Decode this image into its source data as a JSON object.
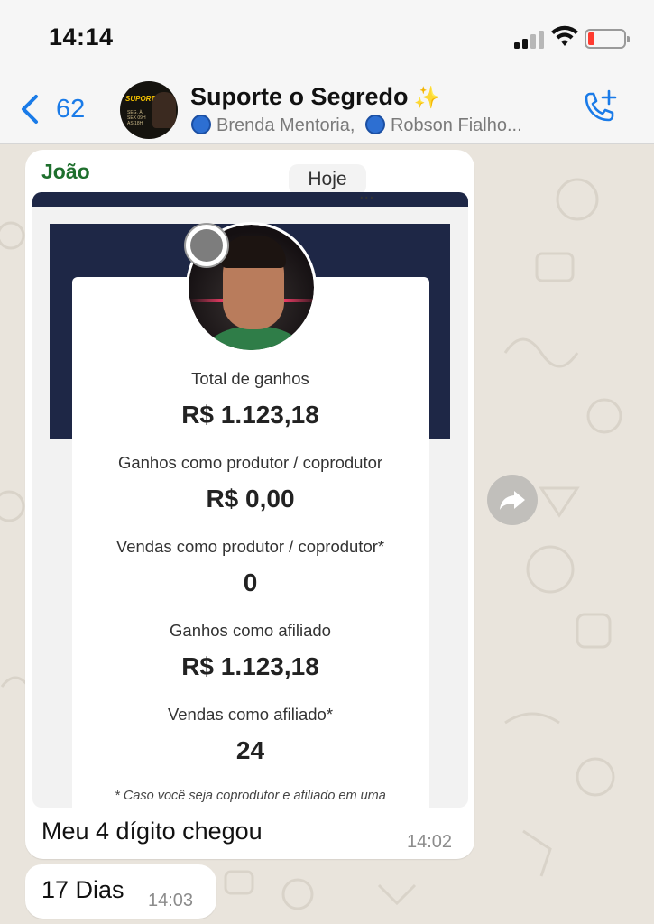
{
  "status_bar": {
    "time": "14:14",
    "battery_color": "#ff3b30"
  },
  "header": {
    "back_count": "62",
    "title": "Suporte o Segredo",
    "title_emoji": "✨",
    "participants": [
      "Brenda Mentoria,",
      "Robson Fialho..."
    ],
    "avatar_text": "SUPORTE",
    "avatar_subtext": "SEG. À SEX 09H AS 18H",
    "accent_color": "#1a7be8"
  },
  "chat": {
    "date_chip": "Hoje",
    "messages": [
      {
        "sender": "João",
        "sender_color": "#1e6f2d",
        "caption": "Meu 4 dígito chegou",
        "time": "14:02",
        "image": {
          "stats": [
            {
              "label": "Total de ganhos",
              "value": "R$ 1.123,18"
            },
            {
              "label": "Ganhos como produtor / coprodutor",
              "value": "R$ 0,00"
            },
            {
              "label": "Vendas como produtor / coprodutor*",
              "value": "0"
            },
            {
              "label": "Ganhos como afiliado",
              "value": "R$ 1.123,18"
            },
            {
              "label": "Vendas como afiliado*",
              "value": "24"
            }
          ],
          "footnote": "* Caso você seja coprodutor e afiliado em uma",
          "banner_color": "#1e2746"
        }
      },
      {
        "text": "17 Dias",
        "time": "14:03"
      }
    ]
  }
}
